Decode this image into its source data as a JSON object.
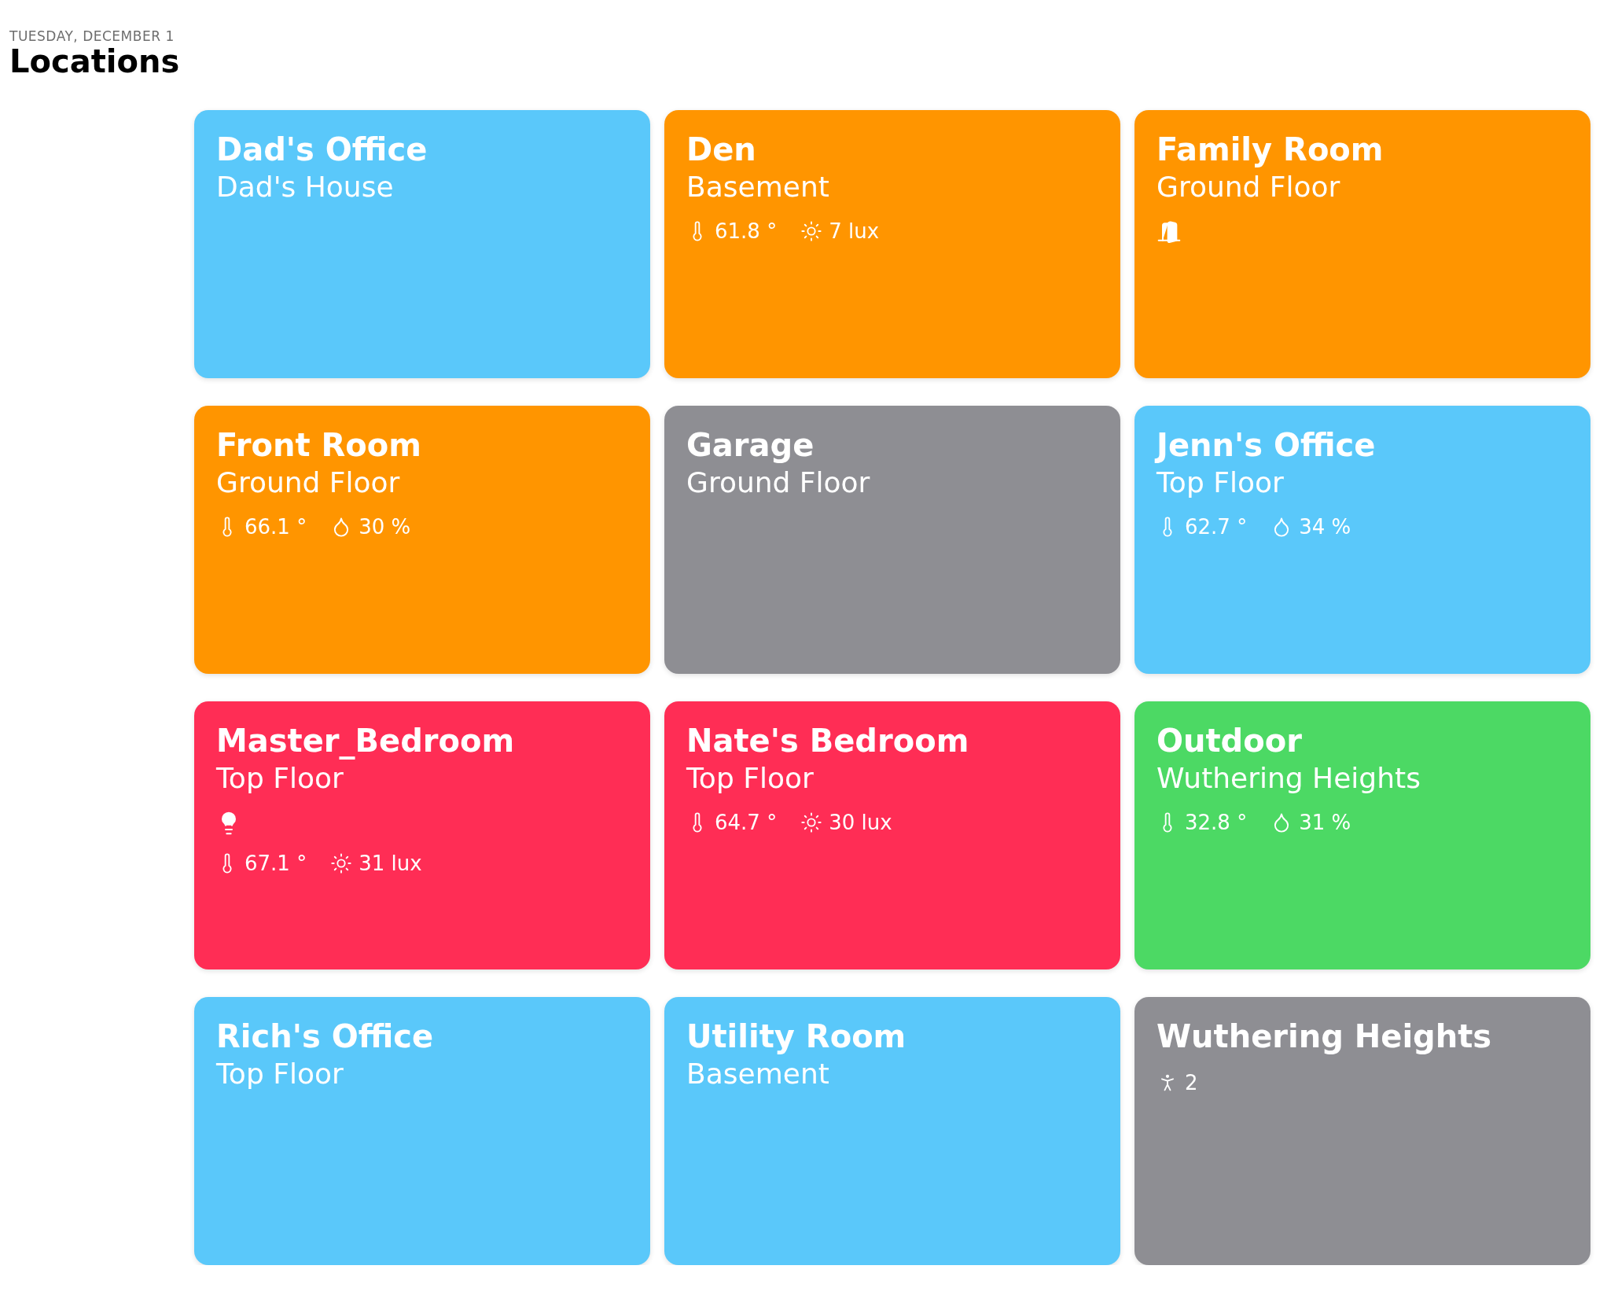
{
  "header": {
    "date": "TUESDAY, DECEMBER 1",
    "title": "Locations"
  },
  "cards": [
    {
      "title": "Dad's Office",
      "subtitle": "Dad's House",
      "color": "#5ac8fa"
    },
    {
      "title": "Den",
      "subtitle": "Basement",
      "color": "#ff9500",
      "sensors": [
        {
          "kind": "temperature",
          "value": "61.8 °"
        },
        {
          "kind": "light",
          "value": "7 lux"
        }
      ]
    },
    {
      "title": "Family Room",
      "subtitle": "Ground Floor",
      "color": "#ff9500",
      "devices": [
        {
          "kind": "door"
        }
      ]
    },
    {
      "title": "Front Room",
      "subtitle": "Ground Floor",
      "color": "#ff9500",
      "sensors": [
        {
          "kind": "temperature",
          "value": "66.1 °"
        },
        {
          "kind": "humidity",
          "value": "30 %"
        }
      ]
    },
    {
      "title": "Garage",
      "subtitle": "Ground Floor",
      "color": "#8e8e93"
    },
    {
      "title": "Jenn's Office",
      "subtitle": "Top Floor",
      "color": "#5ac8fa",
      "sensors": [
        {
          "kind": "temperature",
          "value": "62.7 °"
        },
        {
          "kind": "humidity",
          "value": "34 %"
        }
      ]
    },
    {
      "title": "Master_Bedroom",
      "subtitle": "Top Floor",
      "color": "#ff2d55",
      "devices": [
        {
          "kind": "bulb"
        }
      ],
      "sensors": [
        {
          "kind": "temperature",
          "value": "67.1 °"
        },
        {
          "kind": "light",
          "value": "31 lux"
        }
      ]
    },
    {
      "title": "Nate's Bedroom",
      "subtitle": "Top Floor",
      "color": "#ff2d55",
      "sensors": [
        {
          "kind": "temperature",
          "value": "64.7 °"
        },
        {
          "kind": "light",
          "value": "30 lux"
        }
      ]
    },
    {
      "title": "Outdoor",
      "subtitle": "Wuthering Heights",
      "color": "#4cd964",
      "sensors": [
        {
          "kind": "temperature",
          "value": "32.8 °"
        },
        {
          "kind": "humidity",
          "value": "31 %"
        }
      ]
    },
    {
      "title": "Rich's Office",
      "subtitle": "Top Floor",
      "color": "#5ac8fa"
    },
    {
      "title": "Utility Room",
      "subtitle": "Basement",
      "color": "#5ac8fa"
    },
    {
      "title": "Wuthering Heights",
      "color": "#8e8e93",
      "sensors": [
        {
          "kind": "motion",
          "value": "2"
        }
      ]
    }
  ]
}
